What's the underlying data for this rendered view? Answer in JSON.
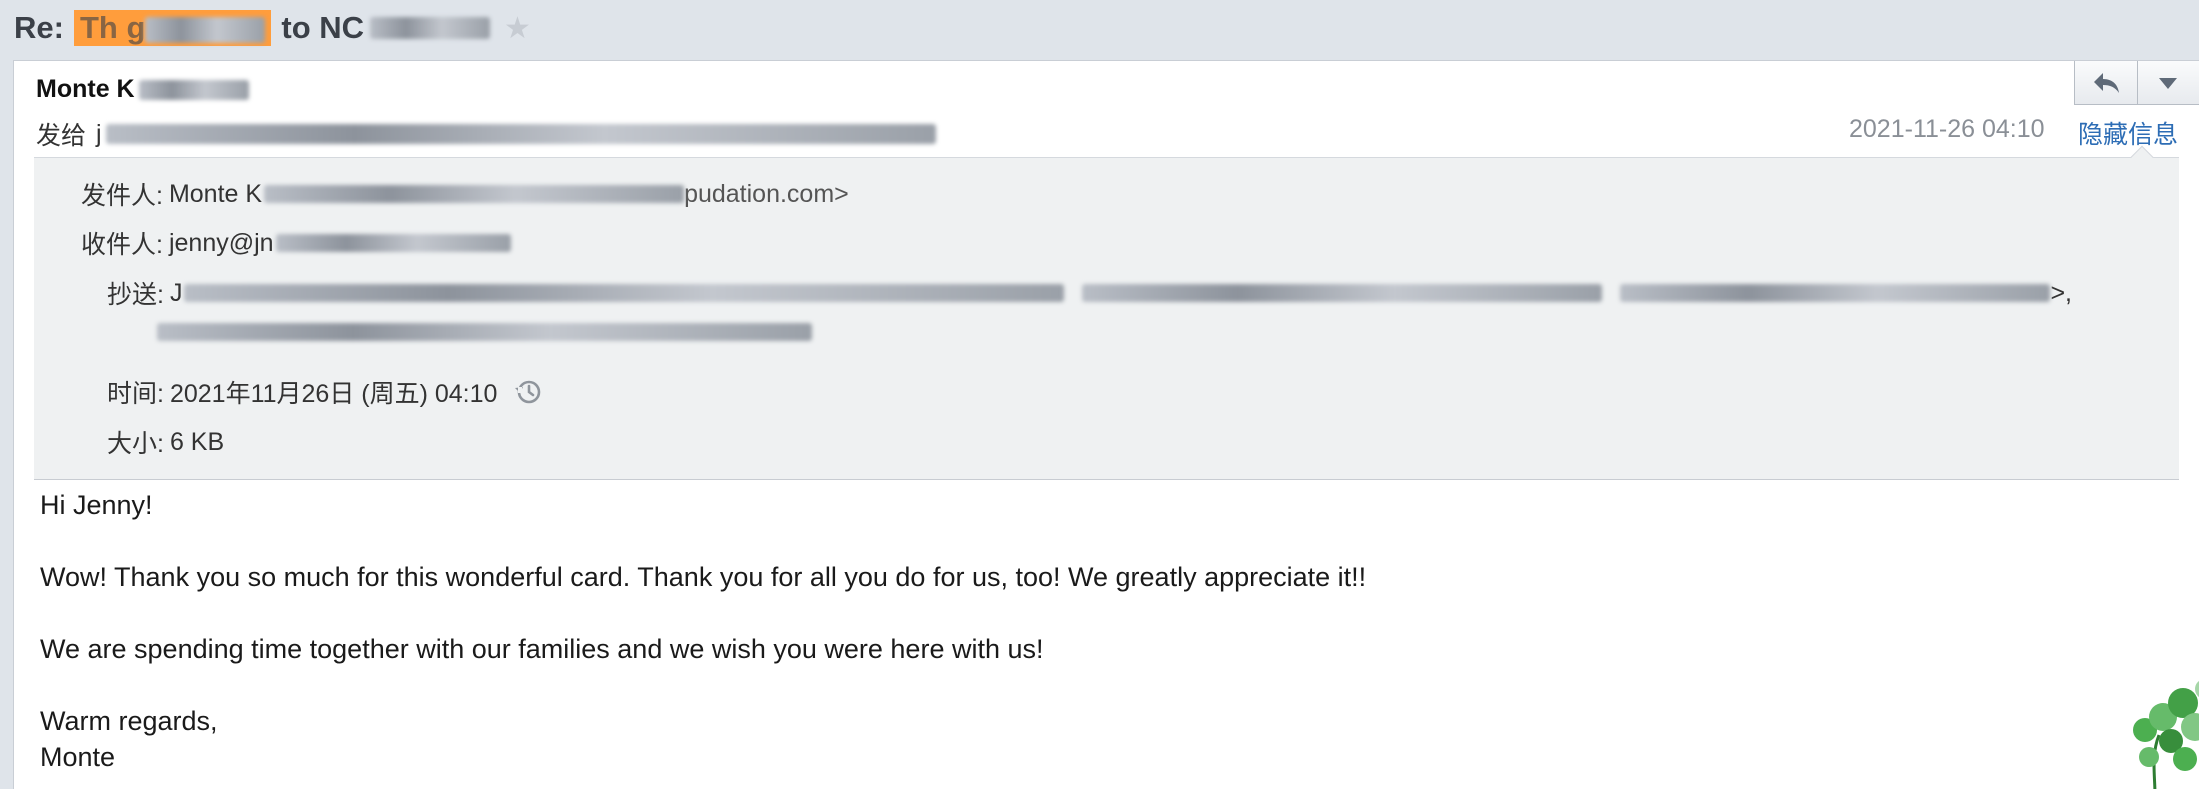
{
  "subject": {
    "prefix": "Re:",
    "highlight": "Th        g",
    "fragment": "to NC",
    "star_icon": "star-icon"
  },
  "sender": {
    "name": "Monte K",
    "sendto_label": "发给",
    "sendto_value": "j"
  },
  "toolbar": {
    "reply_icon": "reply-icon",
    "more_icon": "dropdown-arrow-icon"
  },
  "header_meta": {
    "datetime": "2021-11-26 04:10",
    "hide_info": "隐藏信息"
  },
  "details": {
    "from_label": "发件人:",
    "from_value": "Monte K",
    "from_tail": "pudation.com>",
    "to_label": "收件人:",
    "to_value": "jenny@jn",
    "cc_label": "抄送:",
    "cc_value": "J",
    "cc_tail": ">,",
    "time_label": "时间:",
    "time_value": "2021年11月26日 (周五) 04:10",
    "size_label": "大小:",
    "size_value": "6 KB"
  },
  "message": {
    "greeting": "Hi Jenny!",
    "line1": "Wow!  Thank you so much for this wonderful card. Thank you for all you do for us, too!  We greatly appreciate it!!",
    "line2": "We are spending time together with our families and we wish you were here with us!",
    "closing": "Warm regards,",
    "signature": "Monte"
  },
  "colors": {
    "highlight": "#ff9d3c",
    "link": "#2d6db5",
    "details_bg": "#eff1f2",
    "title_bar_bg": "#dfe4ea"
  }
}
